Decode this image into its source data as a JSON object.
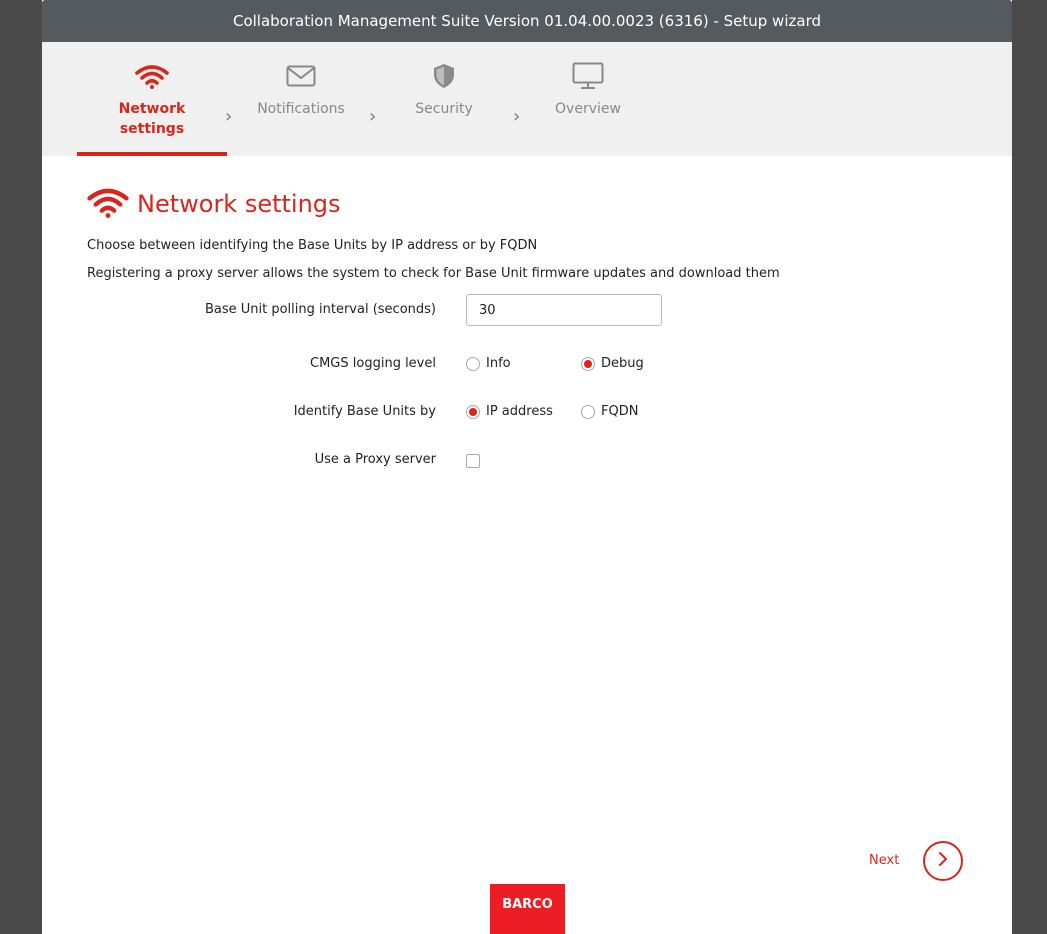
{
  "window": {
    "title": "Collaboration Management Suite Version 01.04.00.0023 (6316) - Setup wizard"
  },
  "steps": [
    {
      "label": "Network settings",
      "icon": "wifi-icon",
      "active": true
    },
    {
      "label": "Notifications",
      "icon": "envelope-icon",
      "active": false
    },
    {
      "label": "Security",
      "icon": "shield-icon",
      "active": false
    },
    {
      "label": "Overview",
      "icon": "monitor-icon",
      "active": false
    }
  ],
  "page": {
    "heading": "Network settings",
    "heading_icon": "wifi-icon",
    "description_1": "Choose between identifying the Base Units by IP address or by FQDN",
    "description_2": "Registering a proxy server allows the system to check for Base Unit firmware updates and download them"
  },
  "form": {
    "polling": {
      "label": "Base Unit polling interval (seconds)",
      "value": "30"
    },
    "logging": {
      "label": "CMGS logging level",
      "options": [
        {
          "label": "Info",
          "selected": false
        },
        {
          "label": "Debug",
          "selected": true
        }
      ]
    },
    "identify": {
      "label": "Identify Base Units by",
      "options": [
        {
          "label": "IP address",
          "selected": true
        },
        {
          "label": "FQDN",
          "selected": false
        }
      ]
    },
    "proxy": {
      "label": "Use a Proxy server",
      "checked": false
    }
  },
  "footer": {
    "next_label": "Next",
    "logo_text": "BARCO"
  },
  "colors": {
    "accent": "#d9261c",
    "titlebar": "#555a5e",
    "stepbar": "#f0f0f0",
    "logo": "#ee1c24"
  }
}
